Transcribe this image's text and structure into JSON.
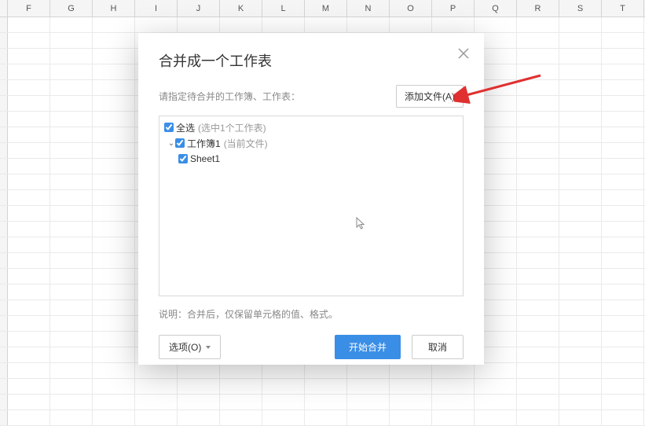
{
  "columns": [
    "F",
    "G",
    "H",
    "I",
    "J",
    "K",
    "L",
    "M",
    "N",
    "O",
    "P",
    "Q",
    "R",
    "S",
    "T"
  ],
  "dialog": {
    "title": "合并成一个工作表",
    "subtitle": "请指定待合并的工作簿、工作表：",
    "add_file_label": "添加文件(A)",
    "explain": "说明：合并后，仅保留单元格的值、格式。",
    "options_label": "选项(O)",
    "start_label": "开始合并",
    "cancel_label": "取消"
  },
  "tree": {
    "select_all_label": "全选",
    "select_all_hint": "(选中1个工作表)",
    "workbook_label": "工作簿1",
    "workbook_hint": "(当前文件)",
    "sheet_label": "Sheet1"
  },
  "annotation": {
    "arrow_color": "#e03030"
  }
}
